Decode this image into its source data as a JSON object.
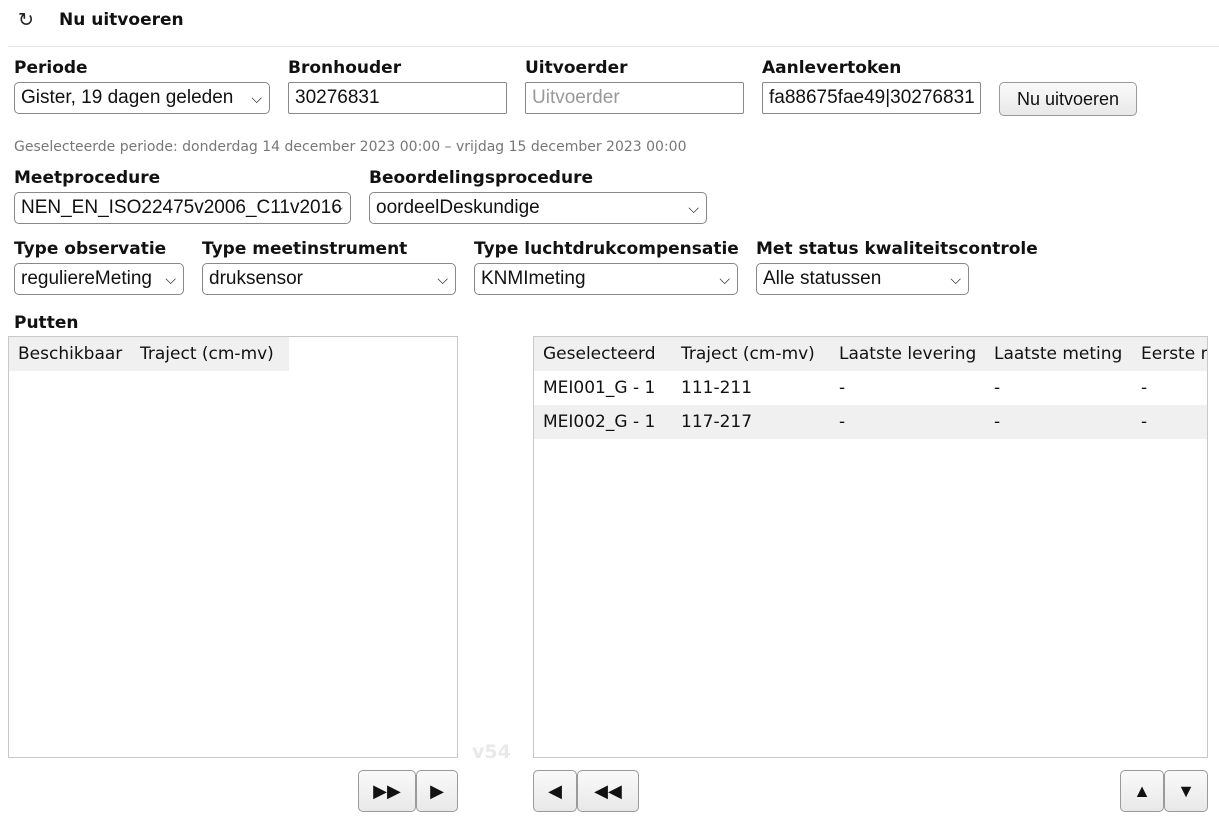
{
  "header": {
    "title": "Nu uitvoeren",
    "refresh_icon": "refresh-icon"
  },
  "filters": {
    "periode": {
      "label": "Periode",
      "value": "Gister, 19 dagen geleden"
    },
    "bronhouder": {
      "label": "Bronhouder",
      "value": "30276831"
    },
    "uitvoerder": {
      "label": "Uitvoerder",
      "placeholder": "Uitvoerder",
      "value": ""
    },
    "aanlevertoken": {
      "label": "Aanlevertoken",
      "value": "fa88675fae49|30276831"
    },
    "run_button": "Nu uitvoeren",
    "period_info": "Geselecteerde periode: donderdag 14 december 2023 00:00 – vrijdag 15 december 2023 00:00",
    "meetprocedure": {
      "label": "Meetprocedure",
      "value": "NEN_EN_ISO22475v2006_C11v2016"
    },
    "beoordelingsprocedure": {
      "label": "Beoordelingsprocedure",
      "value": "oordeelDeskundige"
    },
    "type_observatie": {
      "label": "Type observatie",
      "value": "reguliereMeting"
    },
    "type_meetinstrument": {
      "label": "Type meetinstrument",
      "value": "druksensor"
    },
    "type_luchtdruk": {
      "label": "Type luchtdrukcompensatie",
      "value": "KNMImeting"
    },
    "status_kwaliteit": {
      "label": "Met status kwaliteitscontrole",
      "value": "Alle statussen"
    }
  },
  "putten": {
    "label": "Putten",
    "available": {
      "headers": [
        "Beschikbaar",
        "Traject (cm-mv)"
      ],
      "rows": []
    },
    "selected": {
      "headers": [
        "Geselecteerd",
        "Traject (cm-mv)",
        "Laatste levering",
        "Laatste meting",
        "Eerste m"
      ],
      "rows": [
        [
          "MEI001_G - 1",
          "111-211",
          "-",
          "-",
          "-"
        ],
        [
          "MEI002_G - 1",
          "117-217",
          "-",
          "-",
          "-"
        ]
      ]
    },
    "buttons": {
      "add_all": "▶▶",
      "add_one": "▶",
      "remove_one": "◀",
      "remove_all": "◀◀",
      "move_up": "▲",
      "move_down": "▼"
    }
  },
  "version": "v54"
}
